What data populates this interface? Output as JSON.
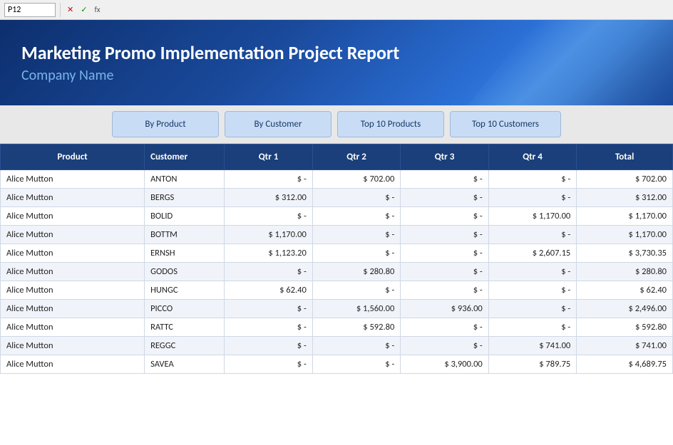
{
  "formula_bar": {
    "cell_ref": "P12",
    "formula": ""
  },
  "banner": {
    "title": "Marketing Promo Implementation Project Report",
    "subtitle": "Company Name"
  },
  "nav": {
    "tabs": [
      {
        "id": "by-product",
        "label": "By Product"
      },
      {
        "id": "by-customer",
        "label": "By Customer"
      },
      {
        "id": "top10-products",
        "label": "Top 10 Products"
      },
      {
        "id": "top10-customers",
        "label": "Top 10 Customers"
      }
    ]
  },
  "table": {
    "headers": [
      "Product",
      "Customer",
      "Qtr 1",
      "Qtr 2",
      "Qtr 3",
      "Qtr 4",
      "Total"
    ],
    "rows": [
      [
        "Alice Mutton",
        "ANTON",
        "$",
        "-",
        "$",
        "702.00",
        "$",
        "-",
        "$",
        "-",
        "$",
        "702.00"
      ],
      [
        "Alice Mutton",
        "BERGS",
        "$",
        "312.00",
        "$",
        "-",
        "$",
        "-",
        "$",
        "-",
        "$",
        "312.00"
      ],
      [
        "Alice Mutton",
        "BOLID",
        "$",
        "-",
        "$",
        "-",
        "$",
        "-",
        "$",
        "1,170.00",
        "$",
        "1,170.00"
      ],
      [
        "Alice Mutton",
        "BOTTM",
        "$",
        "1,170.00",
        "$",
        "-",
        "$",
        "-",
        "$",
        "-",
        "$",
        "1,170.00"
      ],
      [
        "Alice Mutton",
        "ERNSH",
        "$",
        "1,123.20",
        "$",
        "-",
        "$",
        "-",
        "$",
        "2,607.15",
        "$",
        "3,730.35"
      ],
      [
        "Alice Mutton",
        "GODOS",
        "$",
        "-",
        "$",
        "280.80",
        "$",
        "-",
        "$",
        "-",
        "$",
        "280.80"
      ],
      [
        "Alice Mutton",
        "HUNGC",
        "$",
        "62.40",
        "$",
        "-",
        "$",
        "-",
        "$",
        "-",
        "$",
        "62.40"
      ],
      [
        "Alice Mutton",
        "PICCO",
        "$",
        "-",
        "$",
        "1,560.00",
        "$",
        "936.00",
        "$",
        "-",
        "$",
        "2,496.00"
      ],
      [
        "Alice Mutton",
        "RATTC",
        "$",
        "-",
        "$",
        "592.80",
        "$",
        "-",
        "$",
        "-",
        "$",
        "592.80"
      ],
      [
        "Alice Mutton",
        "REGGC",
        "$",
        "-",
        "$",
        "-",
        "$",
        "-",
        "$",
        "741.00",
        "$",
        "741.00"
      ],
      [
        "Alice Mutton",
        "SAVEA",
        "$",
        "-",
        "$",
        "-",
        "$",
        "3,900.00",
        "$",
        "789.75",
        "$",
        "4,689.75"
      ]
    ]
  }
}
